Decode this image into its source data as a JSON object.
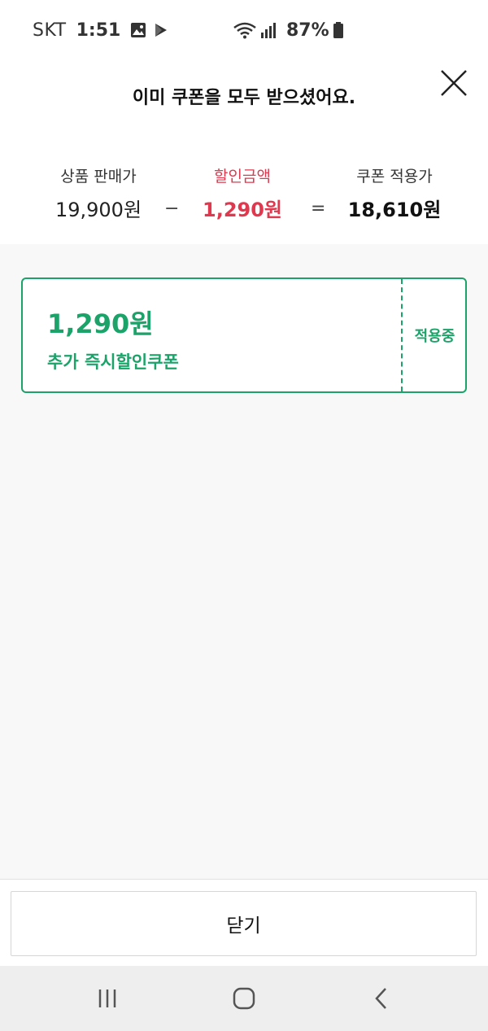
{
  "status_bar": {
    "carrier": "SKT",
    "time": "1:51",
    "battery": "87%"
  },
  "header": {
    "title": "이미 쿠폰을 모두 받으셨어요."
  },
  "summary": {
    "original_label": "상품 판매가",
    "original_value": "19,900원",
    "minus": "−",
    "discount_label": "할인금액",
    "discount_value": "1,290원",
    "equals": "=",
    "final_label": "쿠폰 적용가",
    "final_value": "18,610원"
  },
  "coupon": {
    "amount": "1,290원",
    "name": "추가 즉시할인쿠폰",
    "status": "적용중"
  },
  "footer": {
    "close_label": "닫기"
  },
  "colors": {
    "accent_green": "#1ba36a",
    "discount_red": "#e0384e"
  },
  "icons": [
    "gallery-icon",
    "play-store-icon",
    "wifi-icon",
    "signal-icon",
    "battery-icon",
    "close-icon",
    "recent-apps-icon",
    "home-icon",
    "back-icon"
  ]
}
